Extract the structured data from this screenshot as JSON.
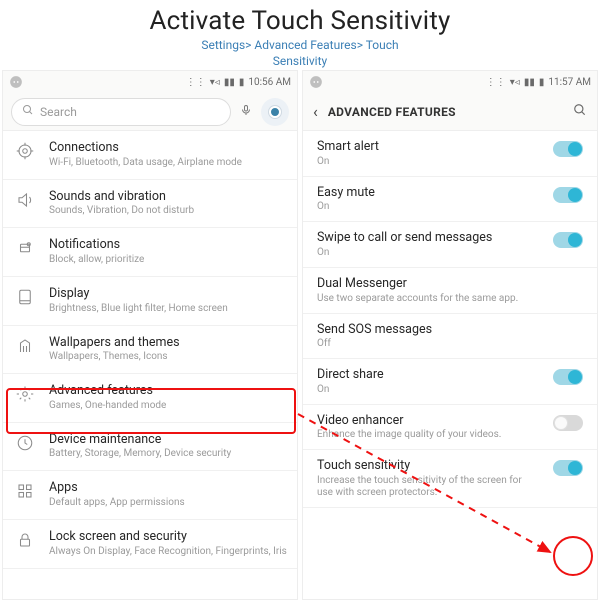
{
  "heading": {
    "title": "Activate Touch Sensitivity",
    "breadcrumb_line1": "Settings> Advanced Features> Touch",
    "breadcrumb_line2": "Sensitivity"
  },
  "left": {
    "status_time": "10:56 AM",
    "search_placeholder": "Search",
    "items": [
      {
        "icon": "connections",
        "title": "Connections",
        "sub": "Wi-Fi, Bluetooth, Data usage, Airplane mode"
      },
      {
        "icon": "sound",
        "title": "Sounds and vibration",
        "sub": "Sounds, Vibration, Do not disturb"
      },
      {
        "icon": "notifications",
        "title": "Notifications",
        "sub": "Block, allow, prioritize"
      },
      {
        "icon": "display",
        "title": "Display",
        "sub": "Brightness, Blue light filter, Home screen"
      },
      {
        "icon": "wallpaper",
        "title": "Wallpapers and themes",
        "sub": "Wallpapers, Themes, Icons"
      },
      {
        "icon": "advanced",
        "title": "Advanced features",
        "sub": "Games, One-handed mode"
      },
      {
        "icon": "maintenance",
        "title": "Device maintenance",
        "sub": "Battery, Storage, Memory, Device security"
      },
      {
        "icon": "apps",
        "title": "Apps",
        "sub": "Default apps, App permissions"
      },
      {
        "icon": "lock",
        "title": "Lock screen and security",
        "sub": "Always On Display, Face Recognition, Fingerprints, Iris"
      }
    ]
  },
  "right": {
    "status_time": "11:57 AM",
    "header": "ADVANCED FEATURES",
    "items": [
      {
        "title": "Smart alert",
        "sub": "On",
        "toggle": "on"
      },
      {
        "title": "Easy mute",
        "sub": "On",
        "toggle": "on"
      },
      {
        "title": "Swipe to call or send messages",
        "sub": "On",
        "toggle": "on"
      },
      {
        "title": "Dual Messenger",
        "sub": "Use two separate accounts for the same app.",
        "toggle": null
      },
      {
        "title": "Send SOS messages",
        "sub": "Off",
        "toggle": null
      },
      {
        "title": "Direct share",
        "sub": "On",
        "toggle": "on"
      },
      {
        "title": "Video enhancer",
        "sub": "Enhance the image quality of your videos.",
        "toggle": "off"
      },
      {
        "title": "Touch sensitivity",
        "sub": "Increase the touch sensitivity of the screen for use with screen protectors.",
        "toggle": "on"
      }
    ]
  },
  "annotations": {
    "highlight_index_left": 5
  }
}
